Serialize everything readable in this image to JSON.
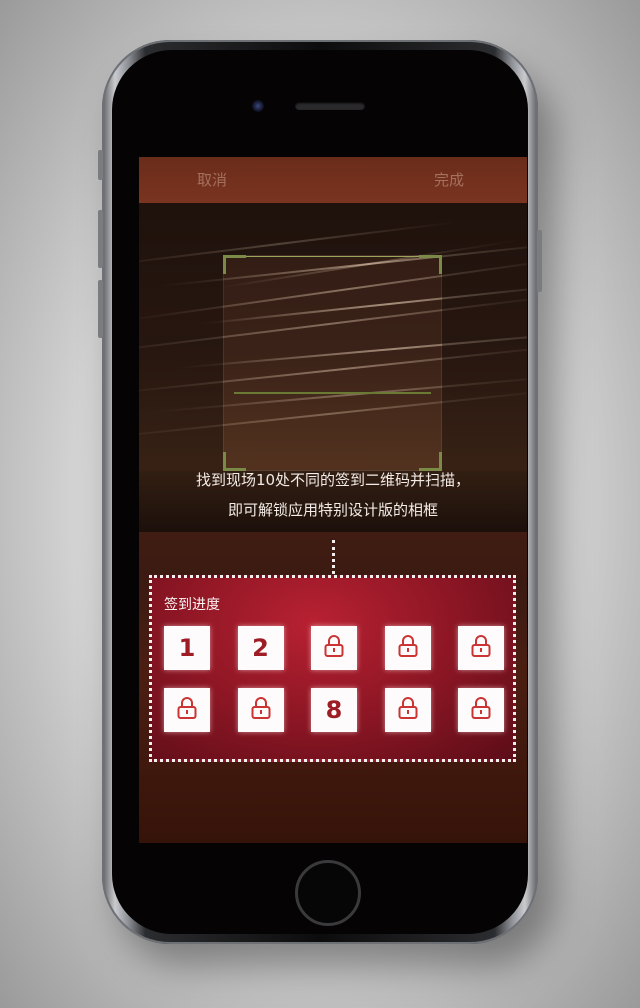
{
  "topbar": {
    "cancel_label": "取消",
    "done_label": "完成"
  },
  "instructions": {
    "line1": "找到现场10处不同的签到二维码并扫描，",
    "line2": "即可解锁应用特别设计版的相框"
  },
  "progress": {
    "title": "签到进度",
    "slots": [
      {
        "state": "unlocked",
        "label": "1"
      },
      {
        "state": "unlocked",
        "label": "2"
      },
      {
        "state": "locked",
        "icon": "lock-icon"
      },
      {
        "state": "locked",
        "icon": "lock-icon"
      },
      {
        "state": "locked",
        "icon": "lock-icon"
      },
      {
        "state": "locked",
        "icon": "lock-icon"
      },
      {
        "state": "locked",
        "icon": "lock-icon"
      },
      {
        "state": "unlocked",
        "label": "8"
      },
      {
        "state": "locked",
        "icon": "lock-icon"
      },
      {
        "state": "locked",
        "icon": "lock-icon"
      }
    ]
  },
  "colors": {
    "accent_red": "#9e1d25",
    "scan_frame_green": "#7c8a48",
    "topbar_text": "#a5705e"
  }
}
